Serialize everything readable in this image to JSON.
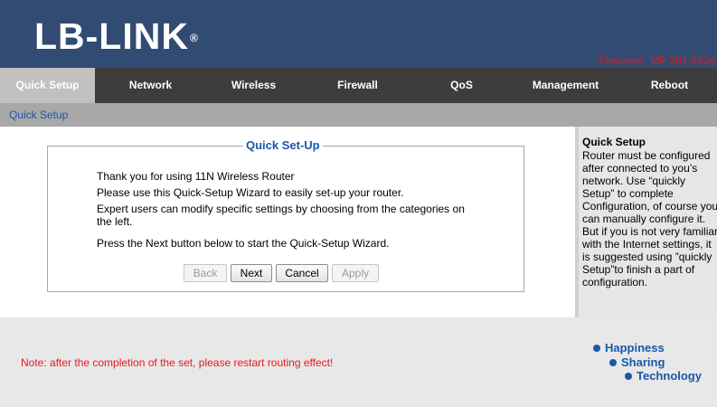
{
  "header": {
    "logo_text": "LB-LINK",
    "logo_reg": "®",
    "firmware": "Firmware: MP 351-532e"
  },
  "nav": {
    "items": [
      {
        "label": "Quick Setup",
        "active": true
      },
      {
        "label": "Network"
      },
      {
        "label": "Wireless"
      },
      {
        "label": "Firewall"
      },
      {
        "label": "QoS"
      },
      {
        "label": "Management"
      },
      {
        "label": "Reboot"
      }
    ]
  },
  "subnav": {
    "link": "Quick Setup"
  },
  "main": {
    "legend": "Quick Set-Up",
    "lines": [
      "Thank you for using 11N Wireless Router",
      "Please use this Quick-Setup Wizard to easily set-up your router.",
      "Expert users can modify specific settings by choosing from the categories on the left.",
      "Press the Next button below to start the Quick-Setup Wizard."
    ],
    "buttons": {
      "back": "Back",
      "next": "Next",
      "cancel": "Cancel",
      "apply": "Apply"
    }
  },
  "sidebar": {
    "title": "Quick Setup",
    "text": "Router must be configured after connected to you’s network. Use “quickly Setup” to complete Configuration, of course you can manually configure it. But if you is not very familiar with the Internet settings, it is suggested using ”quickly Setup”to finish a part of configuration."
  },
  "footer": {
    "note": "Note: after the completion of the set, please restart routing effect!",
    "slogan": [
      "Happiness",
      "Sharing",
      "Technology"
    ]
  },
  "colors": {
    "header_bg": "#324b72",
    "nav_bg": "#3d3d3d",
    "nav_active_bg": "#c0c0c0",
    "accent_blue": "#1a58a8",
    "warning_red": "#e8181a"
  }
}
